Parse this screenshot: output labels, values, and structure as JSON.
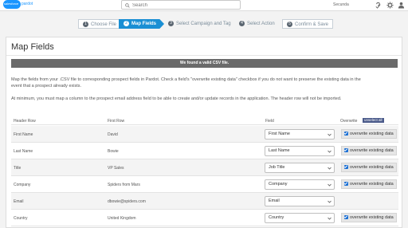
{
  "header": {
    "logo_text": "salesforce",
    "brand": "pardot",
    "search_placeholder": "Search",
    "user_name": "Secunda"
  },
  "steps": [
    {
      "num": "1",
      "label": "Choose File",
      "state": "done"
    },
    {
      "num": "2",
      "label": "Map Fields",
      "state": "active"
    },
    {
      "num": "3",
      "label": "Select Campaign and Tag",
      "state": "upcoming"
    },
    {
      "num": "4",
      "label": "Select Action",
      "state": "upcoming"
    },
    {
      "num": "5",
      "label": "Confirm & Save",
      "state": "upcoming"
    }
  ],
  "page": {
    "title": "Map Fields",
    "banner": "We found a valid CSV file.",
    "para1_line1": "Map the fields from your .CSV file to corresponding prospect fields in Pardot. Check a field's \"overwrite existing data\" checkbox if you do not want to preserve the existing data in the",
    "para1_line2": "event that a prospect already exists.",
    "para2": "At minimum, you must map a column to the prospect email address field to be able to create and/or update records in the application. The header row will not be imported."
  },
  "table": {
    "columns": {
      "header_row": "Header Row",
      "first_row": "First Row",
      "field": "Field",
      "overwrite": "Overwrite",
      "unselect_all": "unselect all"
    },
    "overwrite_label": "overwrite existing data",
    "rows": [
      {
        "header": "First Name",
        "first": "David",
        "field": "First Name",
        "overwrite": true
      },
      {
        "header": "Last Name",
        "first": "Bowie",
        "field": "Last Name",
        "overwrite": true
      },
      {
        "header": "Title",
        "first": "VP Sales",
        "field": "Job Title",
        "overwrite": true
      },
      {
        "header": "Company",
        "first": "Spiders from Mars",
        "field": "Company",
        "overwrite": true
      },
      {
        "header": "Email",
        "first": "dbowie@spiders.com",
        "field": "Email",
        "overwrite": false
      },
      {
        "header": "Country",
        "first": "United Kingdom",
        "field": "Country",
        "overwrite": true
      }
    ]
  },
  "colors": {
    "accent": "#1a8fd4",
    "banner": "#6a6a6a",
    "checkbox": "#1a6fd4"
  }
}
